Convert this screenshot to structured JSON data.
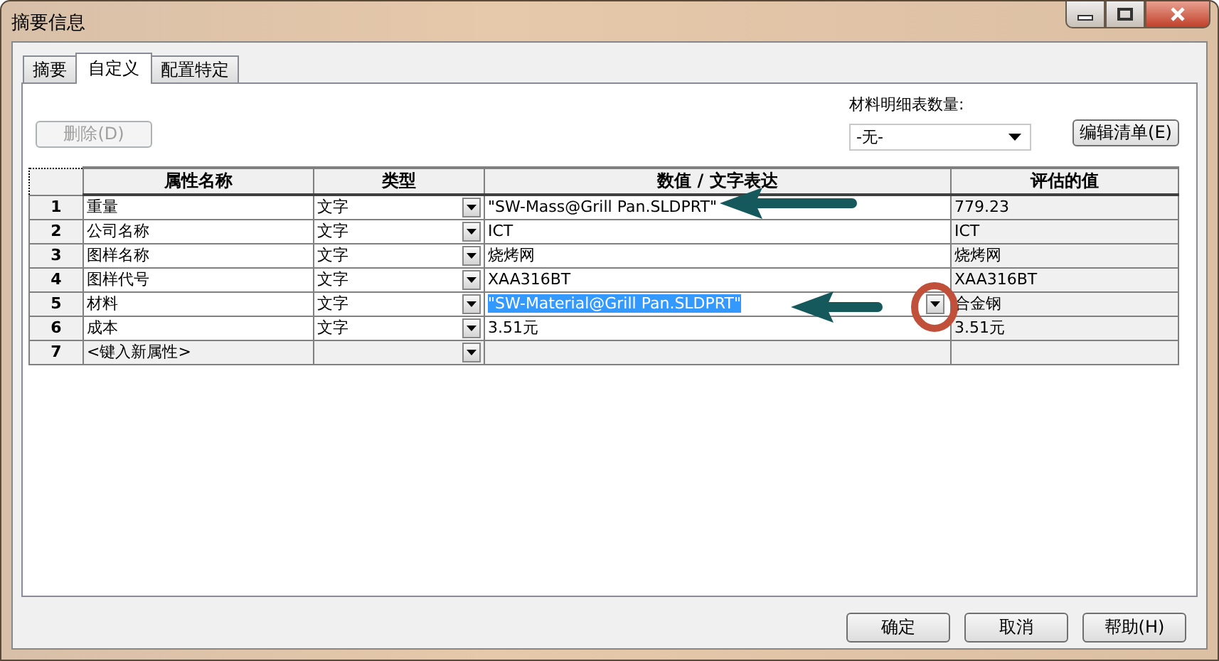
{
  "window": {
    "title": "摘要信息"
  },
  "tabs": [
    {
      "label": "摘要",
      "selected": false
    },
    {
      "label": "自定义",
      "selected": true
    },
    {
      "label": "配置特定",
      "selected": false
    }
  ],
  "delete_button": {
    "label": "删除(D)",
    "disabled": true
  },
  "bom_quantity": {
    "label": "材料明细表数量:",
    "value": "-无-"
  },
  "edit_list_button": {
    "label": "编辑清单(E)"
  },
  "table": {
    "columns": [
      "属性名称",
      "类型",
      "数值 / 文字表达",
      "评估的值"
    ],
    "rows": [
      {
        "kind": "property",
        "index": "1",
        "name": "重量",
        "type": "文字",
        "value": "\"SW-Mass@Grill Pan.SLDPRT\"",
        "evaluated": "779.23",
        "selected": false
      },
      {
        "kind": "property",
        "index": "2",
        "name": "公司名称",
        "type": "文字",
        "value": "ICT",
        "evaluated": "ICT",
        "selected": false
      },
      {
        "kind": "property",
        "index": "3",
        "name": "图样名称",
        "type": "文字",
        "value": "烧烤网",
        "evaluated": "烧烤网",
        "selected": false
      },
      {
        "kind": "property",
        "index": "4",
        "name": "图样代号",
        "type": "文字",
        "value": "XAA316BT",
        "evaluated": "XAA316BT",
        "selected": false
      },
      {
        "kind": "property",
        "index": "5",
        "name": "材料",
        "type": "文字",
        "value": "\"SW-Material@Grill Pan.SLDPRT\"",
        "evaluated": "合金钢",
        "selected": true
      },
      {
        "kind": "property",
        "index": "6",
        "name": "成本",
        "type": "文字",
        "value": "3.51元",
        "evaluated": "3.51元",
        "selected": false
      },
      {
        "kind": "new",
        "index": "7",
        "name": "<键入新属性>",
        "selected": false
      }
    ]
  },
  "buttons": [
    "确定",
    "取消",
    "帮助(H)"
  ]
}
